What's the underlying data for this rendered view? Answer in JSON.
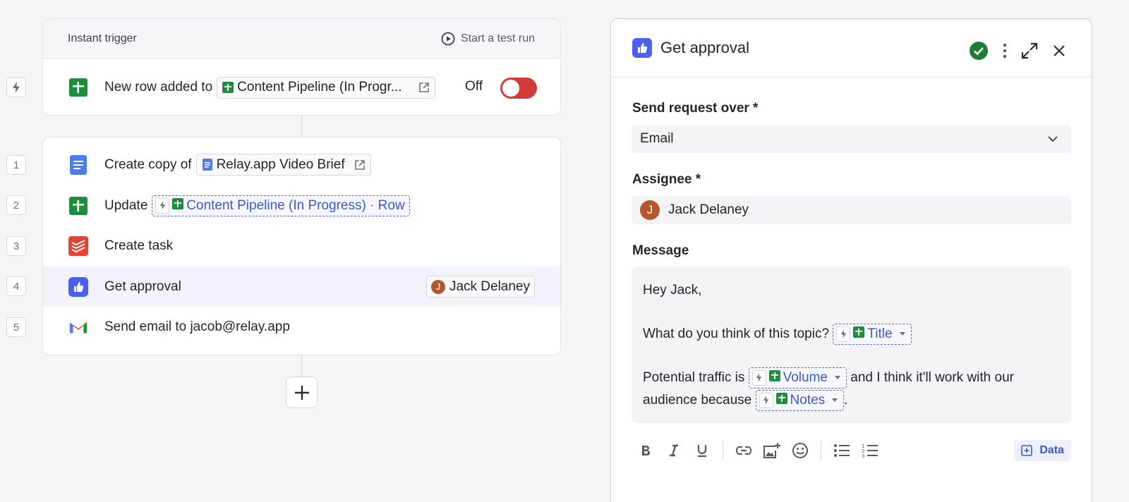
{
  "trigger": {
    "title": "Instant trigger",
    "test_run_label": "Start a test run",
    "row_text": "New row added to",
    "sheet_name": "Content Pipeline (In Progr...",
    "toggle_label": "Off",
    "toggle_state": "off",
    "step_marker_icon": "bolt-icon"
  },
  "steps": [
    {
      "number": "1",
      "icon": "google-docs-icon",
      "text": "Create copy of",
      "chip": "Relay.app Video Brief"
    },
    {
      "number": "2",
      "icon": "google-sheets-icon",
      "text": "Update",
      "data_chip": "Content Pipeline (In Progress) · Row"
    },
    {
      "number": "3",
      "icon": "todoist-icon",
      "text": "Create task"
    },
    {
      "number": "4",
      "icon": "approval-icon",
      "text": "Get approval",
      "assignee_initial": "J",
      "assignee": "Jack Delaney"
    },
    {
      "number": "5",
      "icon": "gmail-icon",
      "text": "Send email to jacob@relay.app"
    }
  ],
  "panel": {
    "title": "Get approval",
    "send_request_label": "Send request over *",
    "send_request_value": "Email",
    "assignee_label": "Assignee *",
    "assignee_initial": "J",
    "assignee_value": "Jack Delaney",
    "message_label": "Message",
    "message": {
      "line1": "Hey Jack,",
      "line2": "What do you think of this topic?",
      "var_title": "Title",
      "line3_a": "Potential traffic is",
      "var_volume": "Volume",
      "line3_b": "and I think it'll work with our",
      "line4_a": "audience because",
      "var_notes": "Notes",
      "line4_b": "."
    },
    "data_button_label": "Data"
  },
  "colors": {
    "accent": "#3f56d1",
    "toggle_off": "#d33a3a",
    "success": "#1e7a34",
    "sheets_green": "#1e8e3e",
    "docs_blue": "#4a7df0",
    "todoist_red": "#e44332",
    "avatar": "#b5562b"
  }
}
